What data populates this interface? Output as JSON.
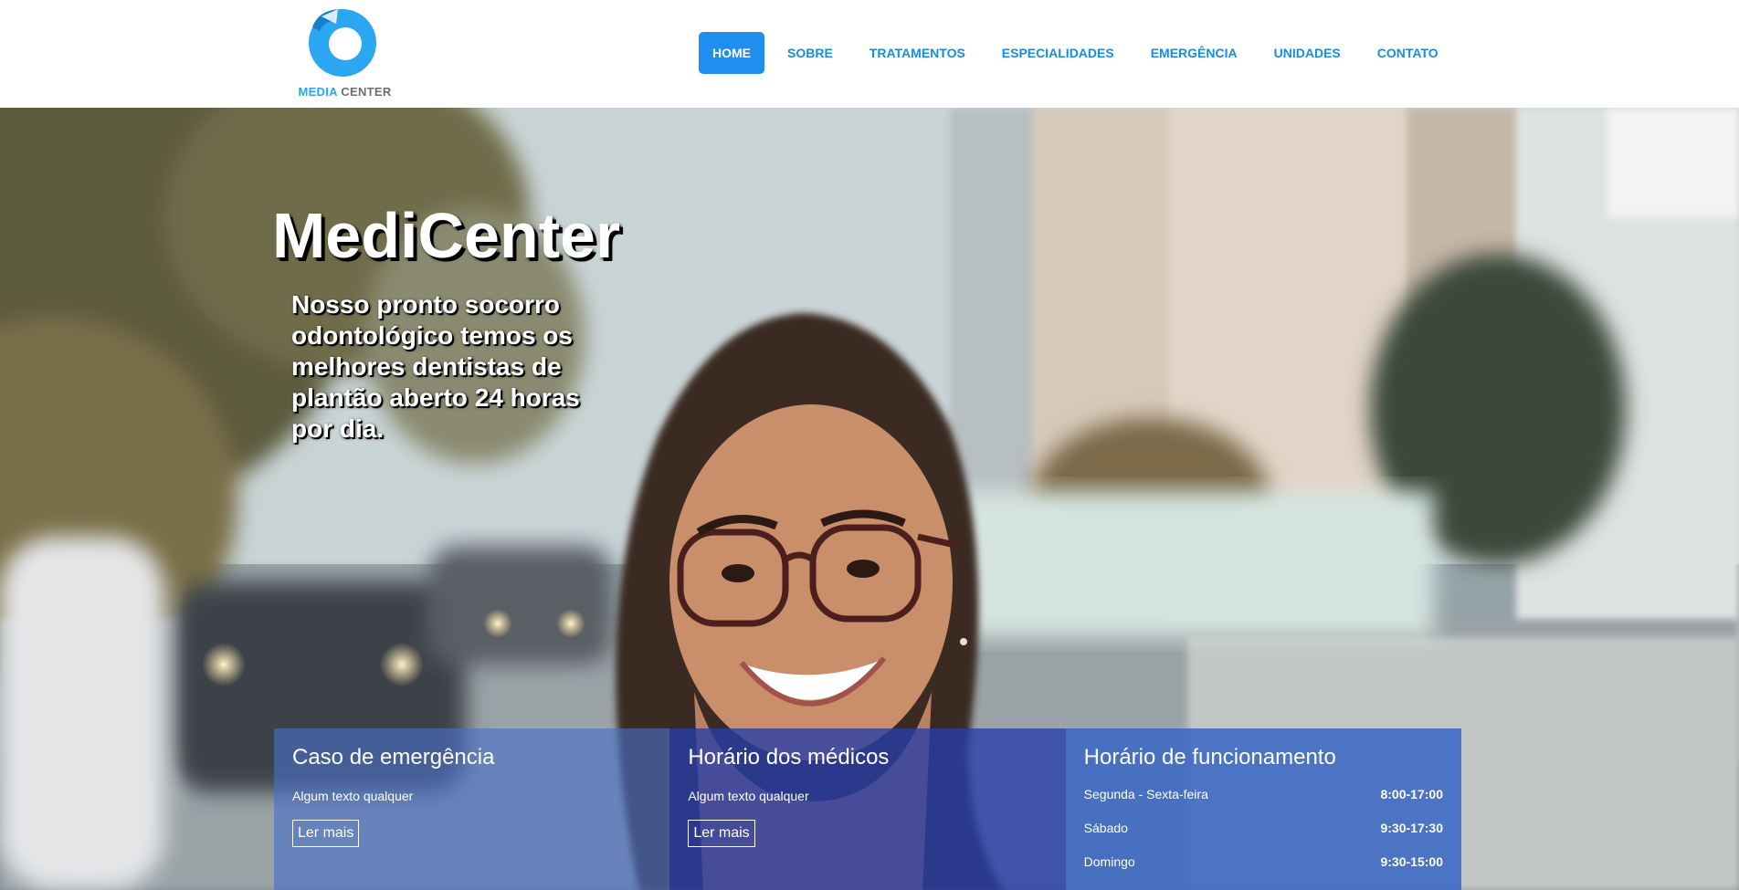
{
  "logo": {
    "word1": "MEDIA",
    "word2": "CENTER",
    "icon": "refresh-ring-logo",
    "color_primary": "#2aa7f0",
    "color_secondary": "#6e6e6e"
  },
  "nav": {
    "items": [
      {
        "label": "HOME",
        "active": true
      },
      {
        "label": "SOBRE",
        "active": false
      },
      {
        "label": "TRATAMENTOS",
        "active": false
      },
      {
        "label": "ESPECIALIDADES",
        "active": false
      },
      {
        "label": "EMERGÊNCIA",
        "active": false
      },
      {
        "label": "UNIDADES",
        "active": false
      },
      {
        "label": "CONTATO",
        "active": false
      }
    ],
    "active_bg": "#1e8ff0",
    "link_color": "#1a8cdf"
  },
  "hero": {
    "title": "MediCenter",
    "subtitle": "Nosso pronto socorro odontológico temos os melhores dentistas de plantão aberto 24 horas por dia."
  },
  "boxes": {
    "emergency": {
      "title": "Caso de emergência",
      "text": "Algum texto qualquer",
      "button": "Ler mais"
    },
    "doctors": {
      "title": "Horário dos médicos",
      "text": "Algum texto qualquer",
      "button": "Ler mais"
    },
    "opening": {
      "title": "Horário de funcionamento",
      "rows": [
        {
          "day": "Segunda - Sexta-feira",
          "time": "8:00-17:00"
        },
        {
          "day": "Sábado",
          "time": "9:30-17:30"
        },
        {
          "day": "Domingo",
          "time": "9:30-15:00"
        }
      ]
    }
  }
}
